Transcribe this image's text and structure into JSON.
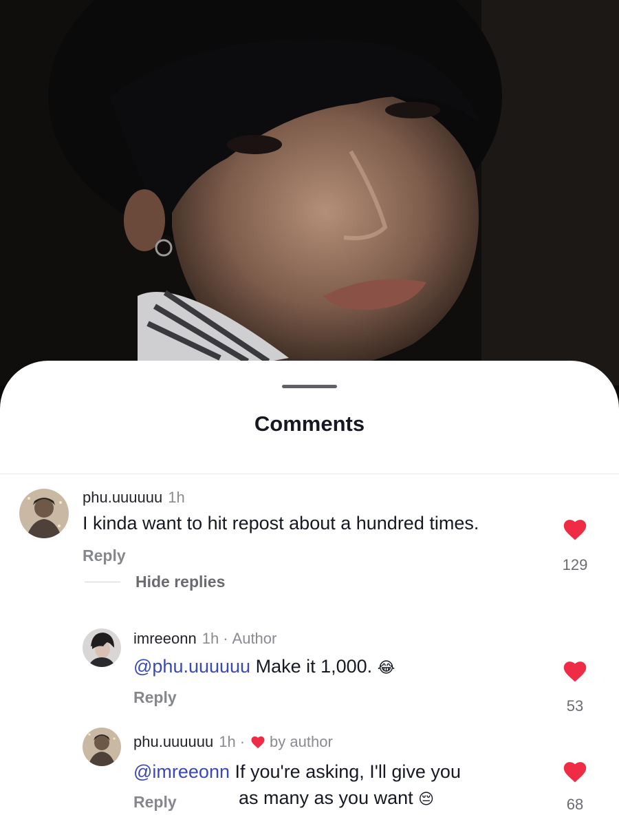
{
  "sheet": {
    "title": "Comments",
    "hide_replies_label": "Hide replies"
  },
  "comments": [
    {
      "username": "phu.uuuuuu",
      "time": "1h",
      "text": "I kinda want to hit repost about a hundred times.",
      "reply_label": "Reply",
      "likes": "129",
      "liked": true
    },
    {
      "username": "imreeonn",
      "time": "1h",
      "separator": "·",
      "badge": "Author",
      "mention": "@phu.uuuuuu",
      "text": "Make it 1,000.",
      "emoji": "😂",
      "reply_label": "Reply",
      "likes": "53",
      "liked": true
    },
    {
      "username": "phu.uuuuuu",
      "time": "1h",
      "separator": "·",
      "badge": "by author",
      "badge_icon": "heart-icon",
      "mention": "@imreeonn",
      "text_line1": "If you're asking, I'll give you",
      "text_line2": "as many as you want",
      "emoji": "😔",
      "reply_label": "Reply",
      "likes": "68",
      "liked": true
    }
  ],
  "colors": {
    "like_red": "#ef2b45",
    "mention_blue": "#3a48b8",
    "sheet_bg": "#ffffff"
  }
}
